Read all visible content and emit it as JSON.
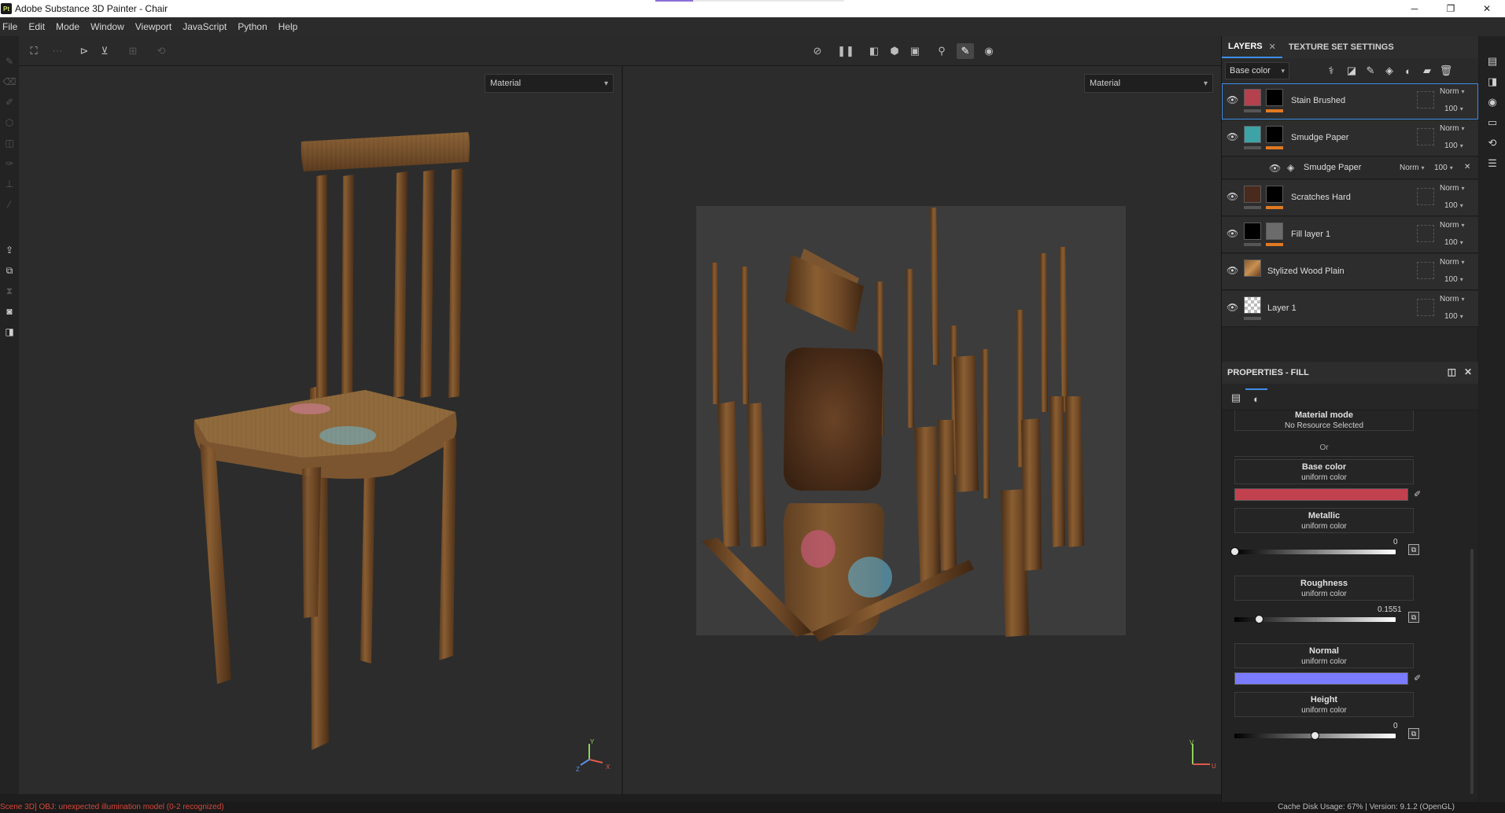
{
  "window": {
    "title": "Adobe Substance 3D Painter - Chair",
    "app_icon": "Pt",
    "controls": [
      "minimize-icon",
      "maximize-icon",
      "close-icon"
    ]
  },
  "menu": [
    "File",
    "Edit",
    "Mode",
    "Window",
    "Viewport",
    "JavaScript",
    "Python",
    "Help"
  ],
  "viewport_3d": {
    "mode_label": "Material",
    "gizmo_labels": {
      "y": "Y",
      "z": "Z",
      "x": "X"
    }
  },
  "viewport_2d": {
    "mode_label": "Material",
    "gizmo_labels": {
      "v": "V",
      "u": "U"
    }
  },
  "layers_panel": {
    "tabs": [
      {
        "label": "LAYERS",
        "active": true
      },
      {
        "label": "TEXTURE SET SETTINGS",
        "active": false
      }
    ],
    "channel": "Base color",
    "items": [
      {
        "name": "Stain Brushed",
        "blend": "Norm",
        "opacity": "100",
        "thumb_color": "#b5414e",
        "has_mask": true,
        "selected": true
      },
      {
        "name": "Smudge Paper",
        "blend": "Norm",
        "opacity": "100",
        "thumb_color": "#3ea3a6",
        "has_mask": true,
        "selected": false
      },
      {
        "name": "Smudge Paper",
        "blend": "Norm",
        "opacity": "100",
        "sub": true
      },
      {
        "name": "Scratches Hard",
        "blend": "Norm",
        "opacity": "100",
        "thumb_color": "#4a2a1c",
        "has_mask": true,
        "selected": false
      },
      {
        "name": "Fill layer 1",
        "blend": "Norm",
        "opacity": "100",
        "thumb_color": "#000000",
        "has_mask": true,
        "selected": false
      },
      {
        "name": "Stylized Wood Plain",
        "blend": "Norm",
        "opacity": "100",
        "thumb_color": "#8a5a2e",
        "has_mask": false,
        "selected": false
      },
      {
        "name": "Layer 1",
        "blend": "Norm",
        "opacity": "100",
        "thumb_color": "#bdbdbd",
        "has_mask": false,
        "selected": false
      }
    ]
  },
  "properties": {
    "title": "PROPERTIES - FILL",
    "material_mode": {
      "title": "Material mode",
      "value": "No Resource Selected"
    },
    "or_label": "Or",
    "channels": [
      {
        "title": "Base color",
        "sub": "uniform color",
        "type": "color",
        "color": "#c2414f"
      },
      {
        "title": "Metallic",
        "sub": "uniform color",
        "type": "slider",
        "value": "0",
        "level": 0.0
      },
      {
        "title": "Roughness",
        "sub": "uniform color",
        "type": "slider",
        "value": "0.1551",
        "level": 0.1551
      },
      {
        "title": "Normal",
        "sub": "uniform color",
        "type": "color",
        "color": "#7b7bff"
      },
      {
        "title": "Height",
        "sub": "uniform color",
        "type": "slider",
        "value": "0",
        "level": 0.5
      }
    ]
  },
  "status": {
    "error": "Scene 3D] OBJ: unexpected illumination model (0-2 recognized)",
    "info": "Cache Disk Usage:   67% | Version: 9.1.2 (OpenGL)"
  }
}
